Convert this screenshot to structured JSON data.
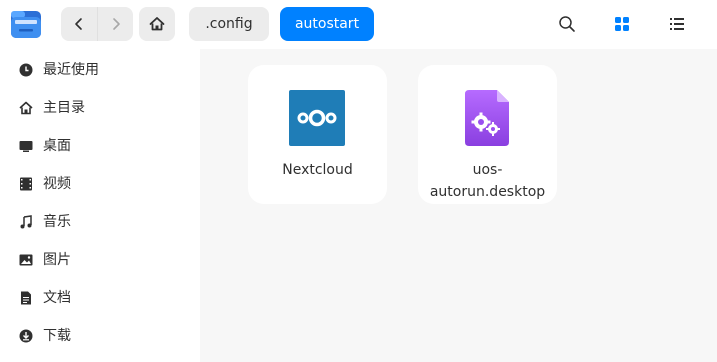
{
  "toolbar": {
    "app_icon": "folder-icon",
    "back_icon": "chevron-left-icon",
    "forward_icon": "chevron-right-icon",
    "home_icon": "home-icon",
    "search_icon": "search-icon",
    "grid_view_icon": "grid-view-icon",
    "list_view_icon": "list-view-icon",
    "accent_color": "#0081ff"
  },
  "breadcrumb": [
    {
      "label": ".config",
      "active": false
    },
    {
      "label": "autostart",
      "active": true
    }
  ],
  "sidebar": {
    "items": [
      {
        "label": "最近使用",
        "icon": "clock-icon"
      },
      {
        "label": "主目录",
        "icon": "home-icon"
      },
      {
        "label": "桌面",
        "icon": "desktop-icon"
      },
      {
        "label": "视频",
        "icon": "video-icon"
      },
      {
        "label": "音乐",
        "icon": "music-icon"
      },
      {
        "label": "图片",
        "icon": "picture-icon"
      },
      {
        "label": "文档",
        "icon": "document-icon"
      },
      {
        "label": "下载",
        "icon": "download-icon"
      }
    ]
  },
  "files": [
    {
      "name": "Nextcloud",
      "icon": "nextcloud-icon"
    },
    {
      "name": "uos-autorun.desktop",
      "line1": "uos-",
      "line2": "autorun.desktop",
      "icon": "desktop-file-gear-icon"
    }
  ]
}
